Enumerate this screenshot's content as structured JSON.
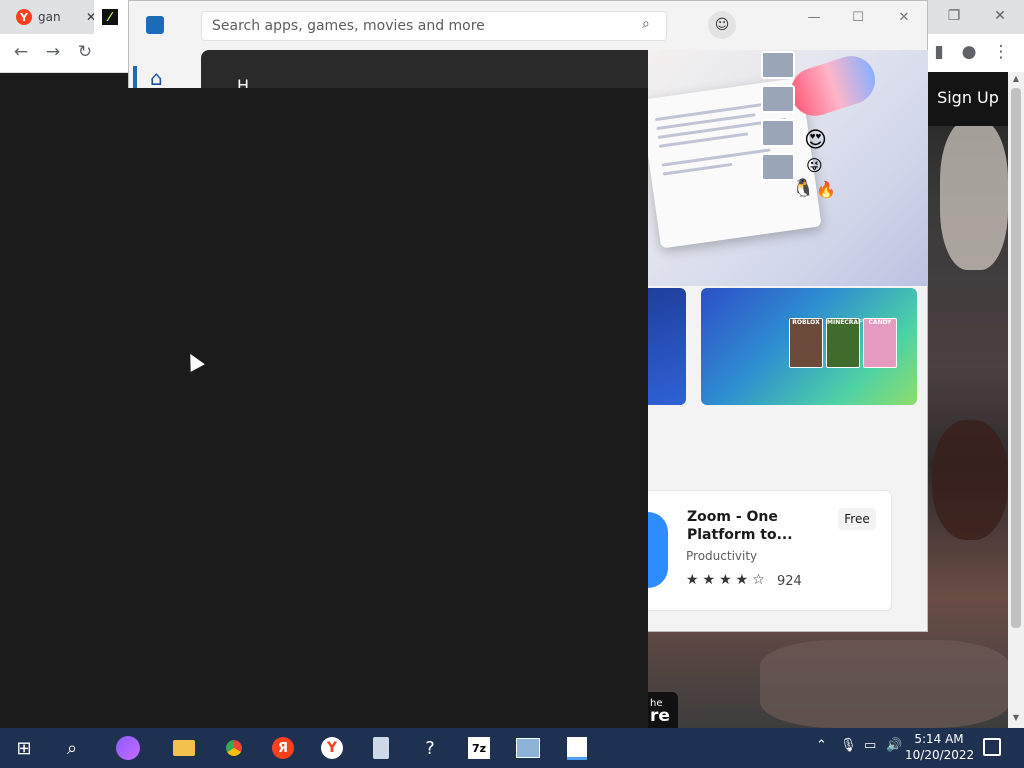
{
  "browser": {
    "tabs": [
      {
        "label": "gan"
      },
      {
        "label": ""
      }
    ],
    "signup_label": "Sign Up"
  },
  "store": {
    "search_placeholder": "Search apps, games, movies and more",
    "hero_peek_text": "H",
    "featured_app": {
      "title": "Zoom - One Platform to...",
      "category": "Productivity",
      "price": "Free",
      "stars": "★★★★☆",
      "rating_count": "924"
    },
    "game_tiles": [
      "ROBLOX",
      "MINECRAFT",
      "CANDY"
    ],
    "promo_text": [
      "he",
      "re"
    ]
  },
  "taskbar": {
    "time": "5:14 AM",
    "date": "10/20/2022"
  },
  "colors": {
    "store_accent": "#1a6bb8",
    "taskbar": "#1f3150",
    "zoom_blue": "#2d8cff",
    "yandex_red": "#fc3f1d"
  },
  "icons": {
    "browser_tab1": "yandex-icon",
    "browser_tab2": "app-favicon-icon",
    "store": "microsoft-store-icon",
    "user": "user-icon",
    "search": "search-icon",
    "home": "home-icon"
  }
}
